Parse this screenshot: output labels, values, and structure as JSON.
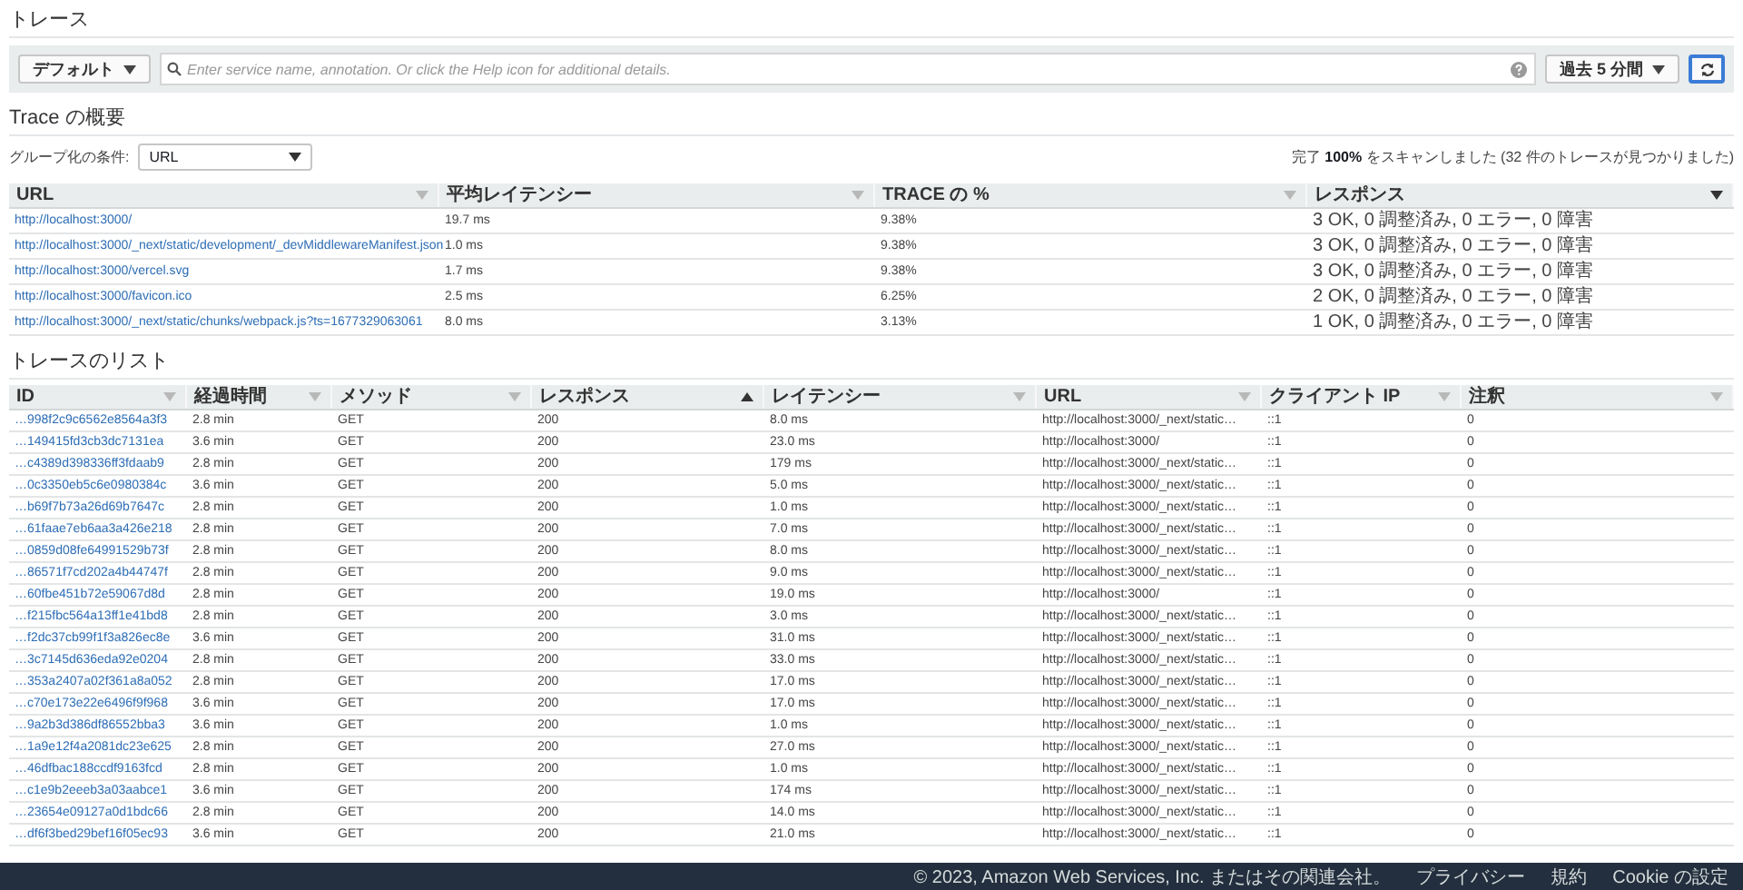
{
  "page_title": "トレース",
  "toolbar": {
    "group_button": "デフォルト",
    "filter_field": {
      "placeholder": "Enter service name, annotation. Or click the Help icon for additional details."
    },
    "time_range": "過去 5 分間"
  },
  "summary": {
    "title": "Trace の概要",
    "group_by": {
      "label": "グループ化の条件:",
      "value": "URL"
    },
    "scan_status": "完了 **100%** をスキャンしました (32 件のトレースが見つかりました)",
    "table": {
      "columns": [
        {
          "label": "URL",
          "kind": "link",
          "sorted": false
        },
        {
          "label": "平均レイテンシー",
          "kind": "text",
          "sorted": false
        },
        {
          "label": "TRACE の %",
          "kind": "text",
          "sorted": false
        },
        {
          "label": "レスポンス",
          "kind": "text",
          "sorted": true,
          "ascending": false
        }
      ],
      "rows": [
        [
          "http://localhost:3000/",
          "19.7 ms",
          "9.38%",
          "3 OK, 0 調整済み, 0 エラー, 0 障害"
        ],
        [
          "http://localhost:3000/_next/static/development/_devMiddlewareManifest.json",
          "1.0 ms",
          "9.38%",
          "3 OK, 0 調整済み, 0 エラー, 0 障害"
        ],
        [
          "http://localhost:3000/vercel.svg",
          "1.7 ms",
          "9.38%",
          "3 OK, 0 調整済み, 0 エラー, 0 障害"
        ],
        [
          "http://localhost:3000/favicon.ico",
          "2.5 ms",
          "6.25%",
          "2 OK, 0 調整済み, 0 エラー, 0 障害"
        ],
        [
          "http://localhost:3000/_next/static/chunks/webpack.js?ts=1677329063061",
          "8.0 ms",
          "3.13%",
          "1 OK, 0 調整済み, 0 エラー, 0 障害"
        ]
      ]
    }
  },
  "trace_list": {
    "title": "トレースのリスト",
    "table": {
      "columns": [
        {
          "label": "ID",
          "kind": "link",
          "sorted": false
        },
        {
          "label": "経過時間",
          "kind": "text",
          "sorted": false
        },
        {
          "label": "メソッド",
          "kind": "text",
          "sorted": false
        },
        {
          "label": "レスポンス",
          "kind": "text",
          "sorted": true,
          "ascending": true
        },
        {
          "label": "レイテンシー",
          "kind": "text",
          "sorted": false
        },
        {
          "label": "URL",
          "kind": "text",
          "sorted": false
        },
        {
          "label": "クライアント IP",
          "kind": "text",
          "sorted": false
        },
        {
          "label": "注釈",
          "kind": "text",
          "sorted": false
        }
      ],
      "rows": [
        [
          "…998f2c9c6562e8564a3f3",
          "2.8 min",
          "GET",
          "200",
          "8.0 ms",
          "http://localhost:3000/_next/static…",
          "::1",
          "0"
        ],
        [
          "…149415fd3cb3dc7131ea",
          "3.6 min",
          "GET",
          "200",
          "23.0 ms",
          "http://localhost:3000/",
          "::1",
          "0"
        ],
        [
          "…c4389d398336ff3fdaab9",
          "2.8 min",
          "GET",
          "200",
          "179 ms",
          "http://localhost:3000/_next/static…",
          "::1",
          "0"
        ],
        [
          "…0c3350eb5c6e0980384c",
          "3.6 min",
          "GET",
          "200",
          "5.0 ms",
          "http://localhost:3000/_next/static…",
          "::1",
          "0"
        ],
        [
          "…b69f7b73a26d69b7647c",
          "2.8 min",
          "GET",
          "200",
          "1.0 ms",
          "http://localhost:3000/_next/static…",
          "::1",
          "0"
        ],
        [
          "…61faae7eb6aa3a426e218",
          "2.8 min",
          "GET",
          "200",
          "7.0 ms",
          "http://localhost:3000/_next/static…",
          "::1",
          "0"
        ],
        [
          "…0859d08fe64991529b73f",
          "2.8 min",
          "GET",
          "200",
          "8.0 ms",
          "http://localhost:3000/_next/static…",
          "::1",
          "0"
        ],
        [
          "…86571f7cd202a4b44747f",
          "2.8 min",
          "GET",
          "200",
          "9.0 ms",
          "http://localhost:3000/_next/static…",
          "::1",
          "0"
        ],
        [
          "…60fbe451b72e59067d8d",
          "2.8 min",
          "GET",
          "200",
          "19.0 ms",
          "http://localhost:3000/",
          "::1",
          "0"
        ],
        [
          "…f215fbc564a13ff1e41bd8",
          "2.8 min",
          "GET",
          "200",
          "3.0 ms",
          "http://localhost:3000/_next/static…",
          "::1",
          "0"
        ],
        [
          "…f2dc37cb99f1f3a826ec8e",
          "3.6 min",
          "GET",
          "200",
          "31.0 ms",
          "http://localhost:3000/_next/static…",
          "::1",
          "0"
        ],
        [
          "…3c7145d636eda92e0204",
          "2.8 min",
          "GET",
          "200",
          "33.0 ms",
          "http://localhost:3000/_next/static…",
          "::1",
          "0"
        ],
        [
          "…353a2407a02f361a8a052",
          "2.8 min",
          "GET",
          "200",
          "17.0 ms",
          "http://localhost:3000/_next/static…",
          "::1",
          "0"
        ],
        [
          "…c70e173e22e6496f9f968",
          "3.6 min",
          "GET",
          "200",
          "17.0 ms",
          "http://localhost:3000/_next/static…",
          "::1",
          "0"
        ],
        [
          "…9a2b3d386df86552bba3",
          "3.6 min",
          "GET",
          "200",
          "1.0 ms",
          "http://localhost:3000/_next/static…",
          "::1",
          "0"
        ],
        [
          "…1a9e12f4a2081dc23e625",
          "2.8 min",
          "GET",
          "200",
          "27.0 ms",
          "http://localhost:3000/_next/static…",
          "::1",
          "0"
        ],
        [
          "…46dfbac188ccdf9163fcd",
          "2.8 min",
          "GET",
          "200",
          "1.0 ms",
          "http://localhost:3000/_next/static…",
          "::1",
          "0"
        ],
        [
          "…c1e9b2eeeb3a03aabce1",
          "3.6 min",
          "GET",
          "200",
          "174 ms",
          "http://localhost:3000/_next/static…",
          "::1",
          "0"
        ],
        [
          "…23654e09127a0d1bdc66",
          "2.8 min",
          "GET",
          "200",
          "14.0 ms",
          "http://localhost:3000/_next/static…",
          "::1",
          "0"
        ],
        [
          "…df6f3bed29bef16f05ec93",
          "3.6 min",
          "GET",
          "200",
          "21.0 ms",
          "http://localhost:3000/_next/static…",
          "::1",
          "0"
        ]
      ]
    }
  },
  "footer": {
    "copyright": "© 2023, Amazon Web Services, Inc. またはその関連会社。",
    "links": [
      "プライバシー",
      "規約",
      "Cookie の設定"
    ]
  }
}
